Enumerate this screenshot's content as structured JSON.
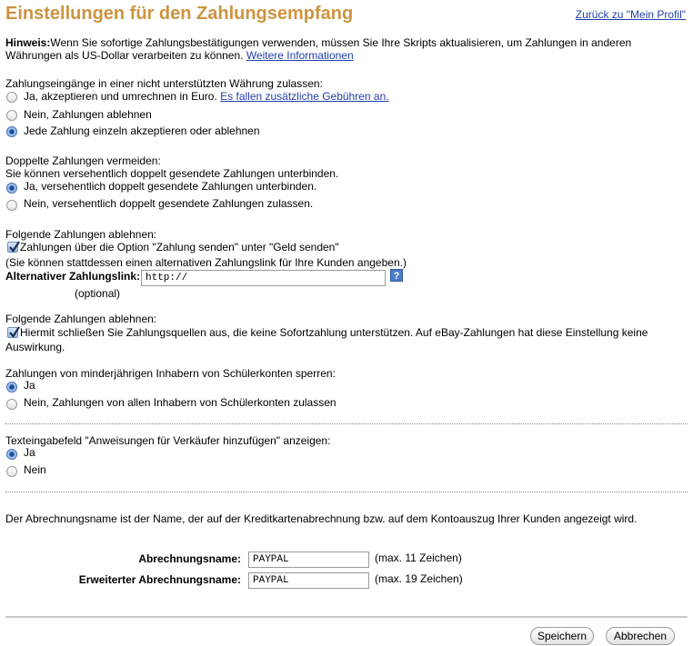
{
  "header": {
    "title": "Einstellungen für den Zahlungsempfang",
    "profile_link": "Zurück zu \"Mein Profil\""
  },
  "notice": {
    "label": "Hinweis:",
    "line1": "Wenn Sie sofortige Zahlungsbestätigungen verwenden, müssen Sie Ihre Skripts aktualisieren, um Zahlungen in anderen",
    "line2": "Währungen als US-Dollar verarbeiten zu können.",
    "link": "Weitere Informationen"
  },
  "currency": {
    "question": "Zahlungseingänge in einer nicht unterstützten Währung zulassen:",
    "opt1": "Ja, akzeptieren und umrechnen in Euro.",
    "opt1_link": "Es fallen zusätzliche Gebühren an.",
    "opt2": "Nein, Zahlungen ablehnen",
    "opt3": "Jede Zahlung einzeln akzeptieren oder ablehnen",
    "selected": 3
  },
  "duplicates": {
    "question": "Doppelte Zahlungen vermeiden:",
    "subtext": "Sie können versehentlich doppelt gesendete Zahlungen unterbinden.",
    "opt1": "Ja, versehentlich doppelt gesendete Zahlungen unterbinden.",
    "opt2": "Nein, versehentlich doppelt gesendete Zahlungen zulassen.",
    "selected": 1
  },
  "block_send": {
    "question": "Folgende Zahlungen ablehnen:",
    "checkbox": "Zahlungen über die Option \"Zahlung senden\" unter \"Geld senden\"",
    "checked": true,
    "note": "(Sie können stattdessen einen alternativen Zahlungslink für Ihre Kunden angeben.)",
    "alt_label": "Alternativer Zahlungslink:",
    "alt_value": "http://",
    "optional": "(optional)",
    "help": "?"
  },
  "block_sources": {
    "question": "Folgende Zahlungen ablehnen:",
    "checkbox_line1": "Hiermit schließen Sie Zahlungsquellen aus, die keine Sofortzahlung unterstützen. Auf eBay-Zahlungen hat diese Einstellung keine",
    "checkbox_line2": "Auswirkung.",
    "checked": true
  },
  "student": {
    "question": "Zahlungen von minderjährigen Inhabern von Schülerkonten sperren:",
    "opt1": "Ja",
    "opt2": "Nein, Zahlungen von allen Inhabern von Schülerkonten zulassen",
    "selected": 1
  },
  "instructions": {
    "question": "Texteingabefeld \"Anweisungen für Verkäufer hinzufügen\" anzeigen:",
    "opt1": "Ja",
    "opt2": "Nein",
    "selected": 1
  },
  "billing": {
    "description": "Der Abrechnungsname ist der Name, der auf der Kreditkartenabrechnung bzw. auf dem Kontoauszug Ihrer Kunden angezeigt wird.",
    "name_label": "Abrechnungsname:",
    "name_value": "PAYPAL",
    "name_hint": "(max. 11 Zeichen)",
    "ext_label": "Erweiterter Abrechnungsname:",
    "ext_value": "PAYPAL",
    "ext_hint": "(max. 19 Zeichen)"
  },
  "buttons": {
    "save": "Speichern",
    "cancel": "Abbrechen"
  }
}
